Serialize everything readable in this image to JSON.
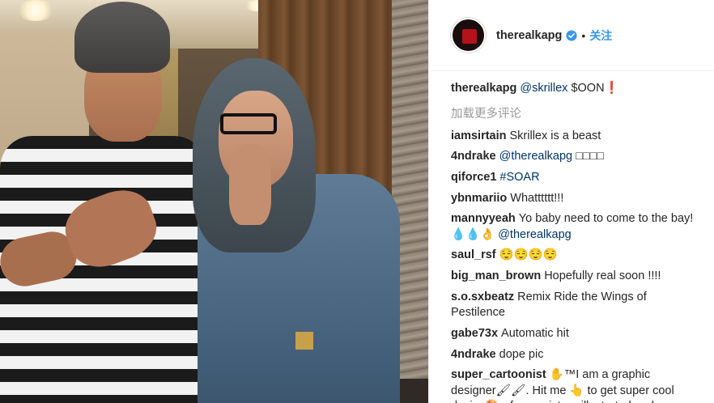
{
  "post": {
    "header": {
      "username": "therealkapg",
      "separator": "•",
      "follow_label": "关注"
    },
    "caption": {
      "username": "therealkapg",
      "mention": "@skrillex",
      "text": "$OON❗"
    },
    "load_more_label": "加载更多评论",
    "comments": [
      {
        "username": "iamsirtain",
        "text": "Skrillex is a beast",
        "tag": ""
      },
      {
        "username": "4ndrake",
        "text": "",
        "tag": "@therealkapg",
        "after": "□□□□"
      },
      {
        "username": "qiforce1",
        "text": "",
        "tag": "#SOAR"
      },
      {
        "username": "ybnmariio",
        "text": "Whatttttt!!!",
        "tag": ""
      },
      {
        "username": "mannyyeah",
        "text": "Yo baby need to come to the bay! 💧💧👌",
        "tag": "@therealkapg"
      },
      {
        "username": "saul_rsf",
        "text": "😌😌😌😌",
        "tag": ""
      },
      {
        "username": "big_man_brown",
        "text": "Hopefully real soon !!!!",
        "tag": ""
      },
      {
        "username": "s.o.sxbeatz",
        "text": "Remix Ride the Wings of Pestilence",
        "tag": ""
      },
      {
        "username": "gabe73x",
        "text": "Automatic hit",
        "tag": ""
      },
      {
        "username": "4ndrake",
        "text": "dope pic",
        "tag": ""
      },
      {
        "username": "super_cartoonist",
        "text": "✋™I am a graphic designer🖌🖌. Hit me 👆 to get super cool design🎨 of your picture illustrated and",
        "tag": ""
      }
    ]
  },
  "colors": {
    "link": "#003569",
    "follow": "#3897f0",
    "muted": "#999999",
    "text": "#262626"
  },
  "icons": {
    "verified": "verified-badge-icon"
  }
}
